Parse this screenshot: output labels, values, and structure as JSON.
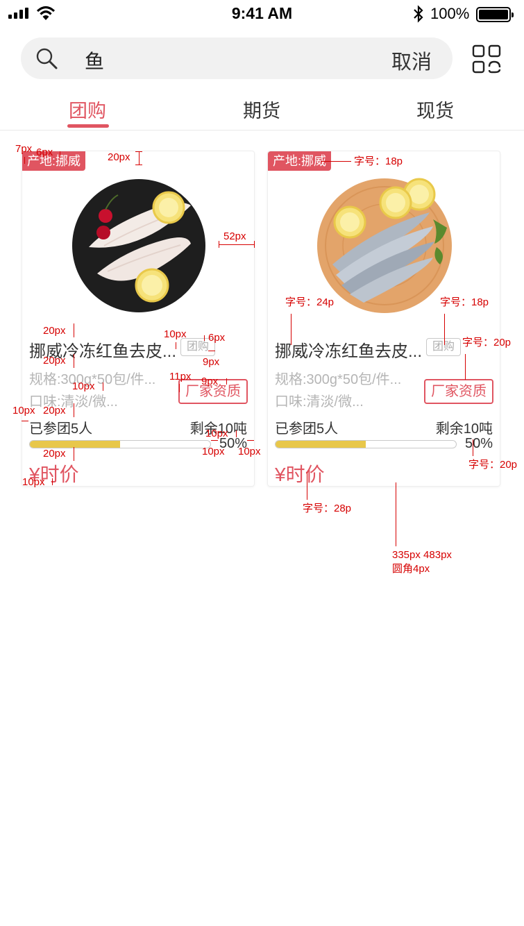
{
  "status_bar": {
    "time": "9:41 AM",
    "battery": "100%"
  },
  "search": {
    "query": "鱼",
    "cancel": "取消"
  },
  "tabs": [
    {
      "label": "团购",
      "active": true
    },
    {
      "label": "期货",
      "active": false
    },
    {
      "label": "现货",
      "active": false
    }
  ],
  "products": [
    {
      "origin": "产地:挪威",
      "name": "挪威冷冻红鱼去皮...",
      "badge": "团购",
      "spec": "规格:300g*50包/件...",
      "taste": "口味:清淡/微...",
      "qualification": "厂家资质",
      "joined": "已参团5人",
      "remaining": "剩余10吨",
      "progress": 0.5,
      "progress_label": "50%",
      "price": "¥时价",
      "image_icon": "fish-fillet-image"
    },
    {
      "origin": "产地:挪威",
      "name": "挪威冷冻红鱼去皮...",
      "badge": "团购",
      "spec": "规格:300g*50包/件...",
      "taste": "口味:清淡/微...",
      "qualification": "厂家资质",
      "joined": "已参团5人",
      "remaining": "剩余10吨",
      "progress": 0.5,
      "progress_label": "50%",
      "price": "¥时价",
      "image_icon": "capelin-fish-image"
    }
  ],
  "colors": {
    "accent": "#e05561",
    "progress": "#e8c74a",
    "annotation": "#d60000"
  },
  "annotations": {
    "a1": "7px",
    "a2": "6px",
    "a3": "20px",
    "a4": "52px",
    "a5": "20px",
    "a6": "20px",
    "a7": "10px",
    "a8": "6px",
    "a9": "9px",
    "a10": "10px",
    "a11": "11px",
    "a12": "9px",
    "a13": "10px",
    "a14": "20px",
    "a15": "10px",
    "a16": "20px",
    "a17": "10px",
    "a18": "10px",
    "a19": "10px",
    "b1": "字号：18p",
    "b2": "字号：24p",
    "b3": "字号：18p",
    "b4": "字号：20p",
    "b5": "字号：20p",
    "b6": "字号：28p",
    "b7": "335px 483px",
    "b8": "圆角4px"
  }
}
